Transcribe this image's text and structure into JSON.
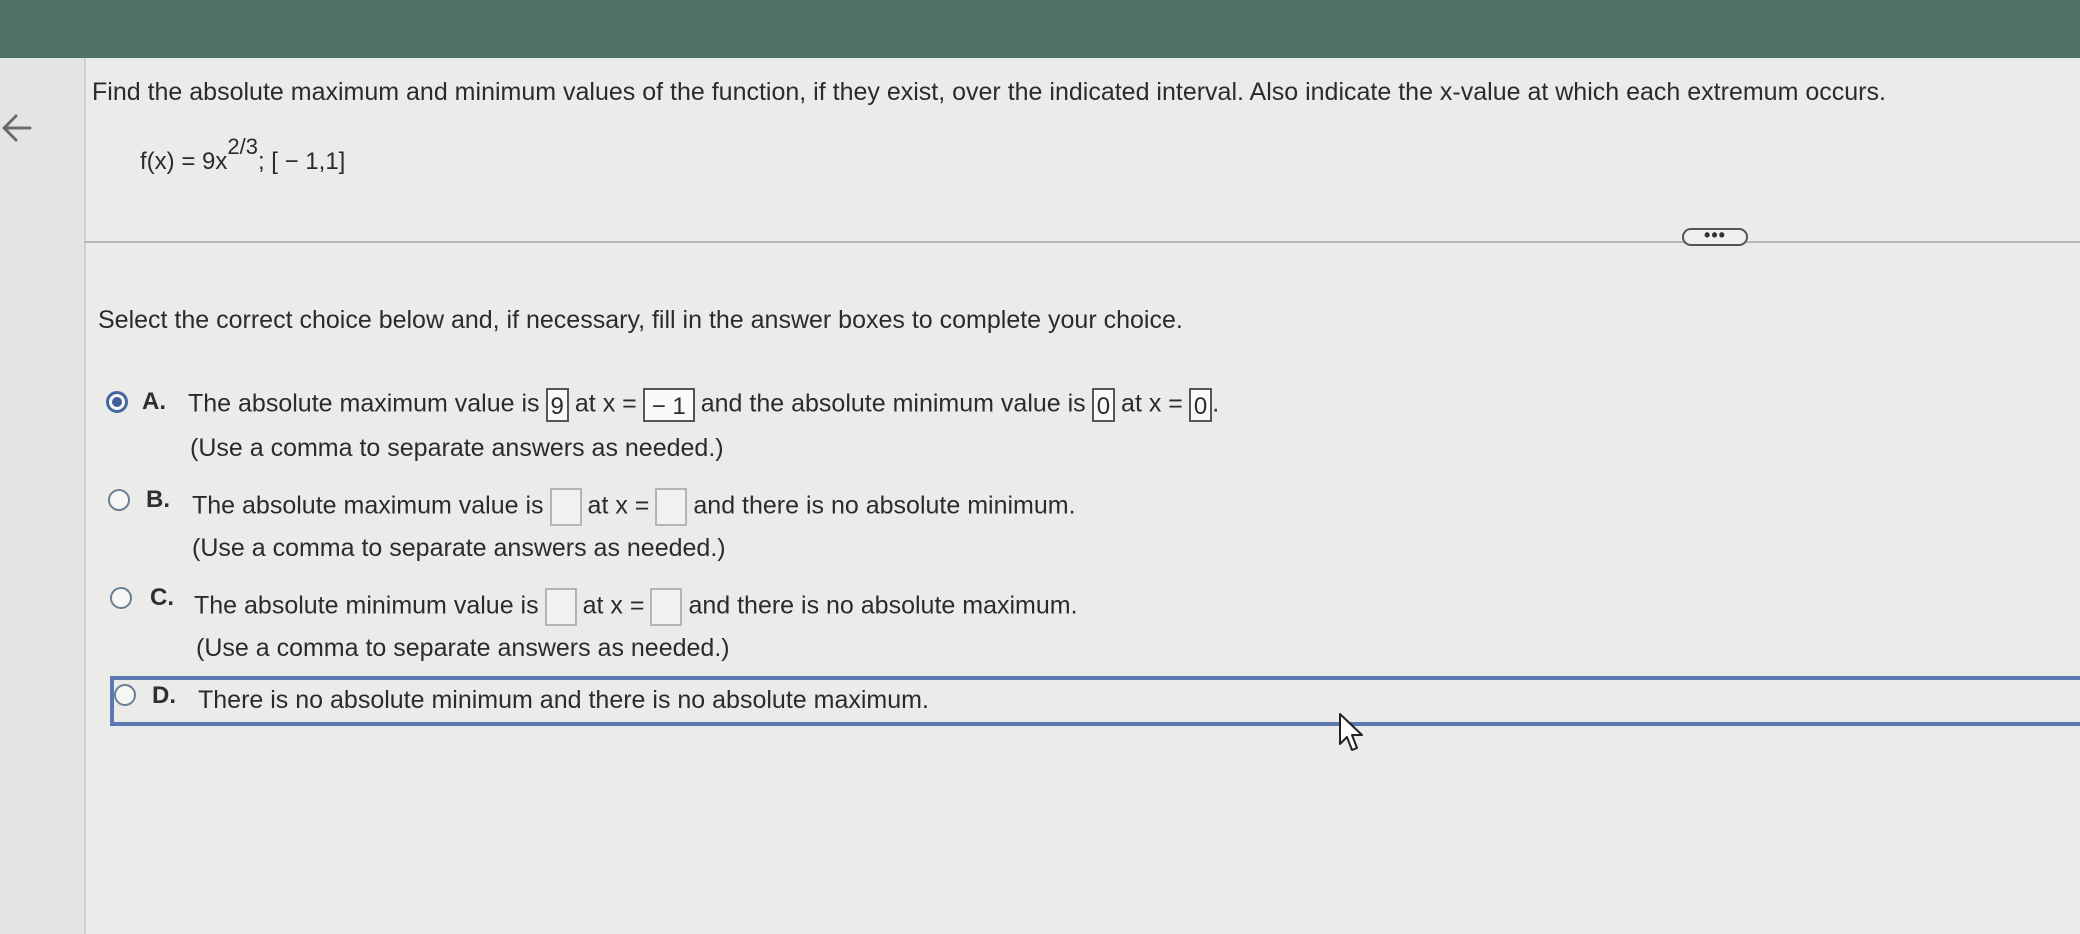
{
  "question": {
    "prompt": "Find the absolute maximum and minimum values of the function, if they exist, over the indicated interval. Also indicate the x-value at which each extremum occurs.",
    "function_lhs": "f(x) = 9x",
    "function_exponent": "2/3",
    "function_interval": "; [ − 1,1]"
  },
  "more_button_label": "•••",
  "instruction": "Select the correct choice below and, if necessary, fill in the answer boxes to complete your choice.",
  "choices": [
    {
      "letter": "A.",
      "selected": true,
      "part1": "The absolute maximum value is",
      "box1": "9",
      "part2": "at x =",
      "box2": "− 1",
      "part3": "and the absolute minimum value is",
      "box3": "0",
      "part4": "at x =",
      "box4": "0",
      "part5": ".",
      "hint": "(Use a comma to separate answers as needed.)"
    },
    {
      "letter": "B.",
      "selected": false,
      "part1": "The absolute maximum value is",
      "part2": "at x =",
      "part3": "and there is no absolute minimum.",
      "hint": "(Use a comma to separate answers as needed.)"
    },
    {
      "letter": "C.",
      "selected": false,
      "part1": "The absolute minimum value is",
      "part2": "at x =",
      "part3": "and there is no absolute maximum.",
      "hint": "(Use a comma to separate answers as needed.)"
    },
    {
      "letter": "D.",
      "selected": false,
      "part1": "There is no absolute minimum and there is no absolute maximum."
    }
  ],
  "colors": {
    "top_bar": "#4e7168",
    "selection_blue": "#5b79b0",
    "background": "#ebebe9"
  },
  "icons": {
    "back": "arrow-left-icon",
    "cursor": "mouse-pointer-icon"
  }
}
